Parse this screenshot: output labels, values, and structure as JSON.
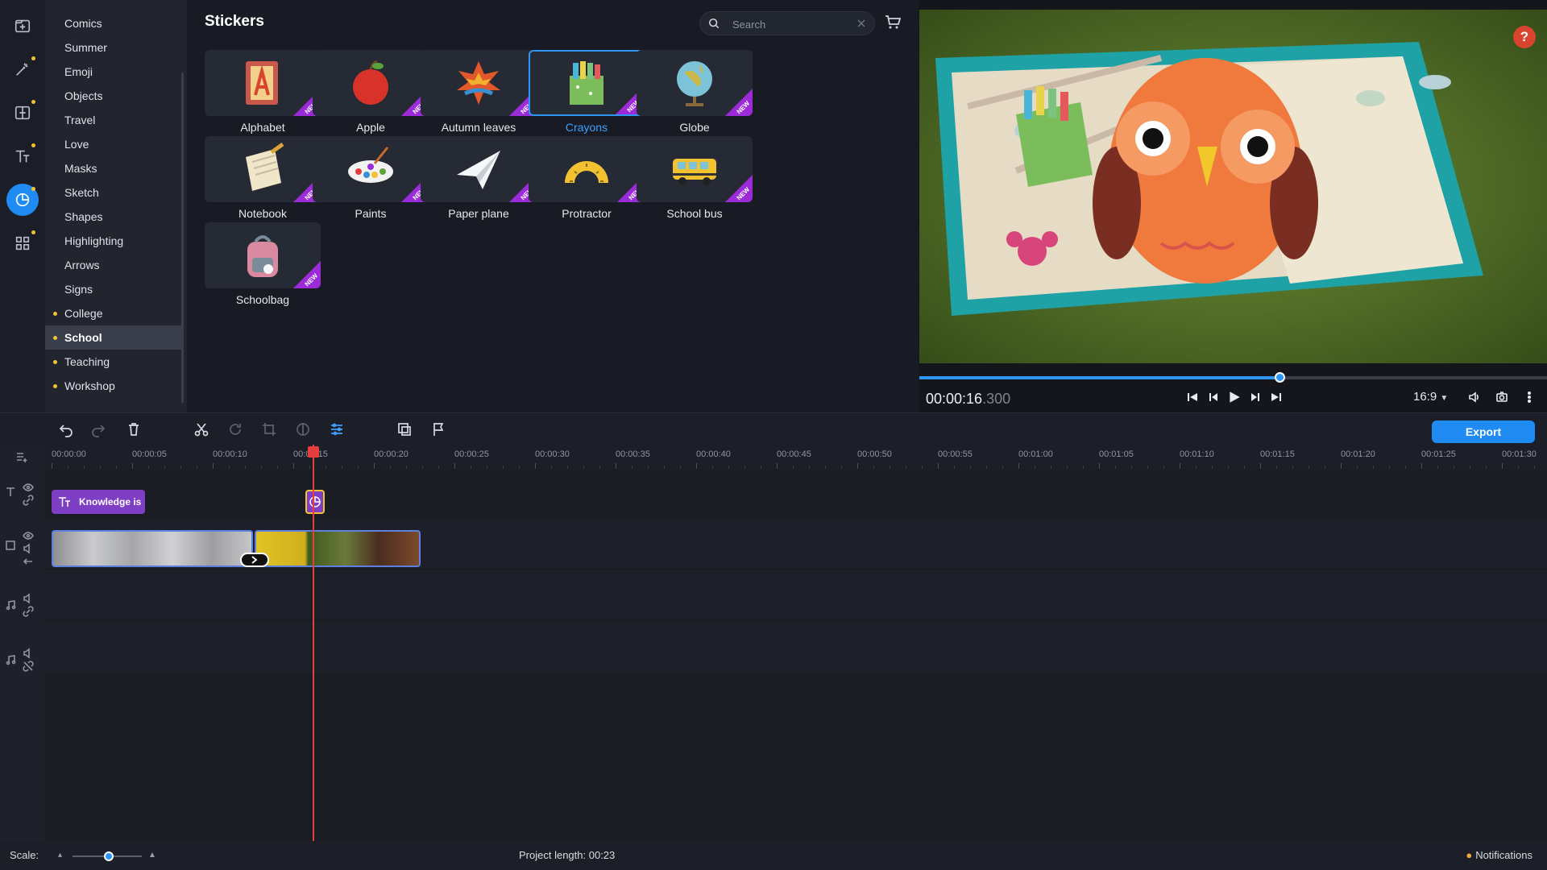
{
  "rail": {
    "items": [
      {
        "name": "import-icon",
        "dot": false
      },
      {
        "name": "magic-wand-icon",
        "dot": true
      },
      {
        "name": "transitions-icon",
        "dot": true
      },
      {
        "name": "titles-icon",
        "dot": true
      },
      {
        "name": "stickers-icon",
        "dot": true,
        "active": true
      },
      {
        "name": "more-tools-icon",
        "dot": true
      }
    ]
  },
  "categories": [
    {
      "label": "Comics",
      "dot": false
    },
    {
      "label": "Summer",
      "dot": false
    },
    {
      "label": "Emoji",
      "dot": false
    },
    {
      "label": "Objects",
      "dot": false
    },
    {
      "label": "Travel",
      "dot": false
    },
    {
      "label": "Love",
      "dot": false
    },
    {
      "label": "Masks",
      "dot": false
    },
    {
      "label": "Sketch",
      "dot": false
    },
    {
      "label": "Shapes",
      "dot": false
    },
    {
      "label": "Highlighting",
      "dot": false
    },
    {
      "label": "Arrows",
      "dot": false
    },
    {
      "label": "Signs",
      "dot": false
    },
    {
      "label": "College",
      "dot": true
    },
    {
      "label": "School",
      "dot": true,
      "selected": true
    },
    {
      "label": "Teaching",
      "dot": true
    },
    {
      "label": "Workshop",
      "dot": true
    }
  ],
  "stickers_panel": {
    "title": "Stickers",
    "search_placeholder": "Search",
    "new_badge": "NEW",
    "items": [
      {
        "label": "Alphabet",
        "icon": "alphabet-book-icon"
      },
      {
        "label": "Apple",
        "icon": "apple-icon"
      },
      {
        "label": "Autumn leaves",
        "icon": "autumn-leaves-icon"
      },
      {
        "label": "Crayons",
        "icon": "crayons-icon",
        "selected": true
      },
      {
        "label": "Globe",
        "icon": "globe-icon"
      },
      {
        "label": "Notebook",
        "icon": "notebook-icon"
      },
      {
        "label": "Paints",
        "icon": "paints-icon"
      },
      {
        "label": "Paper plane",
        "icon": "paper-plane-icon"
      },
      {
        "label": "Protractor",
        "icon": "protractor-icon"
      },
      {
        "label": "School bus",
        "icon": "school-bus-icon"
      },
      {
        "label": "Schoolbag",
        "icon": "schoolbag-icon"
      }
    ]
  },
  "player": {
    "help": "?",
    "progress_fraction": 0.574,
    "timecode_main": "00:00:16",
    "timecode_ms": ".300",
    "aspect_ratio": "16:9"
  },
  "toolbar": {
    "export_label": "Export"
  },
  "timeline": {
    "ruler_labels": [
      "00:00:00",
      "00:00:05",
      "00:00:10",
      "00:00:15",
      "00:00:20",
      "00:00:25",
      "00:00:30",
      "00:00:35",
      "00:00:40",
      "00:00:45",
      "00:00:50",
      "00:00:55",
      "00:01:00",
      "00:01:05",
      "00:01:10",
      "00:01:15",
      "00:01:20",
      "00:01:25",
      "00:01:30"
    ],
    "title_clip_label": "Knowledge is"
  },
  "status": {
    "scale_label": "Scale:",
    "scale_fraction": 0.52,
    "project_length_label": "Project length:",
    "project_length_value": "00:23",
    "notifications_label": "Notifications"
  },
  "colors": {
    "accent": "#1f8bf3",
    "new_ribbon": "#9b2bd8",
    "dot": "#f2c231",
    "playhead": "#e53e3e",
    "title_clip": "#7f3fc4"
  }
}
